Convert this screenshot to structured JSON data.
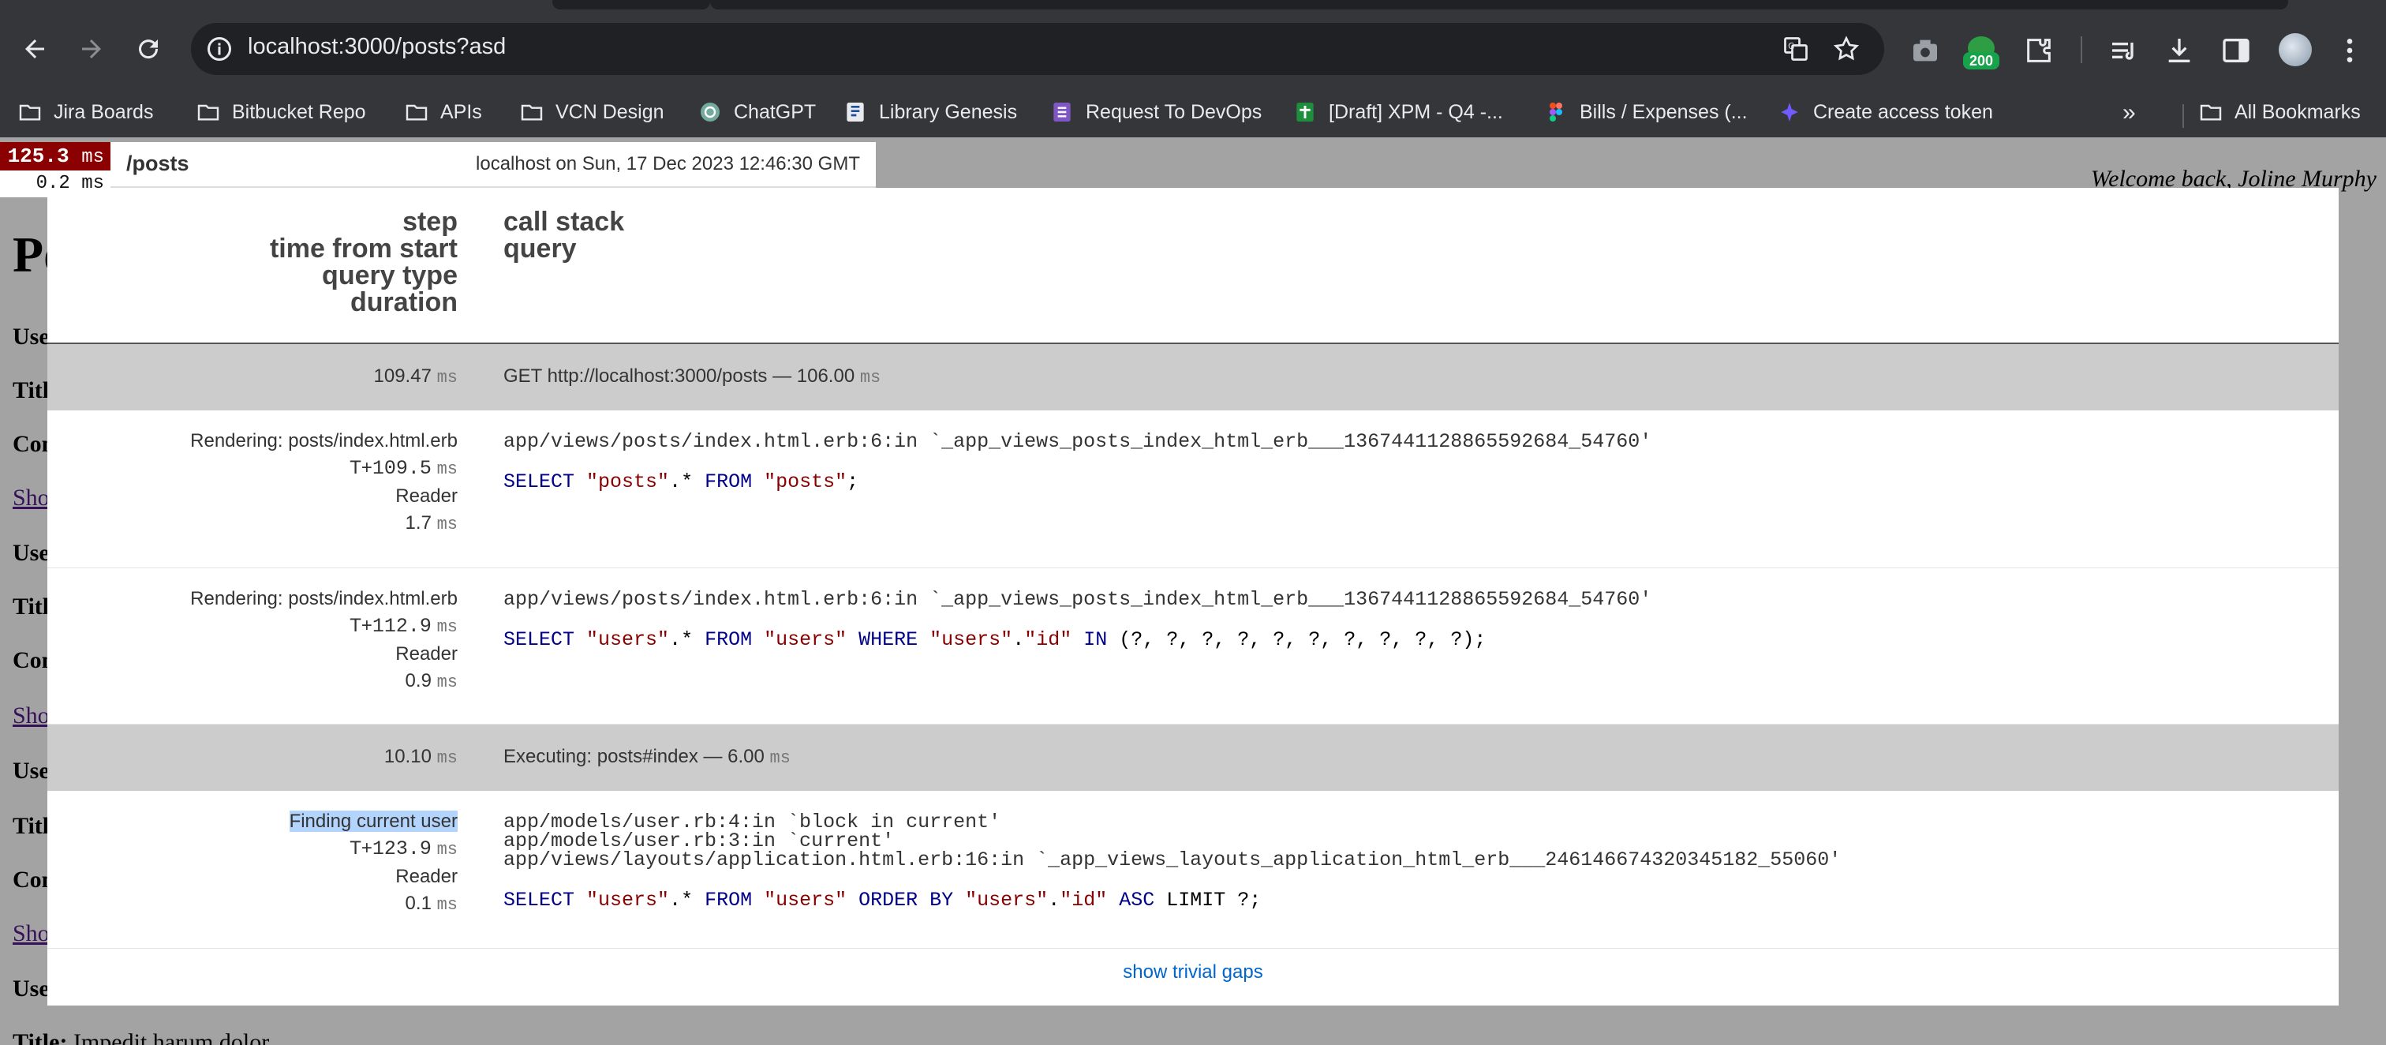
{
  "browser": {
    "url": "localhost:3000/posts?asd",
    "extension_badge": "200",
    "bookmarks": [
      {
        "label": "Jira Boards",
        "icon": "folder-icon"
      },
      {
        "label": "Bitbucket Repo",
        "icon": "folder-icon"
      },
      {
        "label": "APIs",
        "icon": "folder-icon"
      },
      {
        "label": "VCN Design",
        "icon": "folder-icon"
      },
      {
        "label": "ChatGPT",
        "icon": "chatgpt-icon"
      },
      {
        "label": "Library Genesis",
        "icon": "library-icon"
      },
      {
        "label": "Request To DevOps",
        "icon": "form-icon"
      },
      {
        "label": "[Draft] XPM - Q4 -...",
        "icon": "sheets-icon"
      },
      {
        "label": "Bills / Expenses (...",
        "icon": "figma-icon"
      },
      {
        "label": "Create access token",
        "icon": "sparkle-icon"
      }
    ],
    "more_bookmarks": "»",
    "all_bookmarks": "All Bookmarks"
  },
  "page": {
    "heading_fragment": "Po",
    "welcome": "Welcome back, Joline Murphy",
    "labels": [
      "Use",
      "Titl",
      "Con",
      "Use",
      "Titl",
      "Con",
      "Use",
      "Titl",
      "Con",
      "Use"
    ],
    "links": [
      "Sho",
      "Sho",
      "Sho"
    ],
    "last_title_label": "Title:",
    "last_title_value": "Impedit harum dolor"
  },
  "profiler": {
    "badge_total": "125.3",
    "badge_unit": "ms",
    "badge_sub": "0.2 ms",
    "path": "/posts",
    "server_info": "localhost on Sun, 17 Dec 2023 12:46:30 GMT",
    "headers_left": [
      "step",
      "time from start",
      "query type",
      "duration"
    ],
    "headers_right": [
      "call stack",
      "query"
    ],
    "unit": "ms",
    "rows": [
      {
        "kind": "timing",
        "time": "109.47",
        "label": "GET http://localhost:3000/posts — 106.00"
      },
      {
        "kind": "query",
        "step": "Rendering: posts/index.html.erb",
        "start_prefix": "T+",
        "start": "109.5",
        "type": "Reader",
        "duration": "1.7",
        "stack": "app/views/posts/index.html.erb:6:in `_app_views_posts_index_html_erb___1367441128865592684_54760'",
        "sql": [
          {
            "t": "SELECT ",
            "c": "kw"
          },
          {
            "t": "\"posts\"",
            "c": "str"
          },
          {
            "t": ".* ",
            "c": ""
          },
          {
            "t": "FROM ",
            "c": "kw"
          },
          {
            "t": "\"posts\"",
            "c": "str"
          },
          {
            "t": ";",
            "c": ""
          }
        ]
      },
      {
        "kind": "query",
        "step": "Rendering: posts/index.html.erb",
        "start_prefix": "T+",
        "start": "112.9",
        "type": "Reader",
        "duration": "0.9",
        "stack": "app/views/posts/index.html.erb:6:in `_app_views_posts_index_html_erb___1367441128865592684_54760'",
        "sql": [
          {
            "t": "SELECT ",
            "c": "kw"
          },
          {
            "t": "\"users\"",
            "c": "str"
          },
          {
            "t": ".* ",
            "c": ""
          },
          {
            "t": "FROM ",
            "c": "kw"
          },
          {
            "t": "\"users\"",
            "c": "str"
          },
          {
            "t": " ",
            "c": ""
          },
          {
            "t": "WHERE ",
            "c": "kw"
          },
          {
            "t": "\"users\"",
            "c": "str"
          },
          {
            "t": ".",
            "c": ""
          },
          {
            "t": "\"id\"",
            "c": "str"
          },
          {
            "t": " ",
            "c": ""
          },
          {
            "t": "IN ",
            "c": "kw"
          },
          {
            "t": "(?, ?, ?, ?, ?, ?, ?, ?, ?, ?);",
            "c": ""
          }
        ]
      },
      {
        "kind": "timing",
        "time": "10.10",
        "label": "Executing: posts#index — 6.00"
      },
      {
        "kind": "query",
        "step": "Finding current user",
        "highlight": true,
        "start_prefix": "T+",
        "start": "123.9",
        "type": "Reader",
        "duration": "0.1",
        "stack": "app/models/user.rb:4:in `block in current'\napp/models/user.rb:3:in `current'\napp/views/layouts/application.html.erb:16:in `_app_views_layouts_application_html_erb___2461466743203451​82_55060'",
        "sql": [
          {
            "t": "SELECT ",
            "c": "kw"
          },
          {
            "t": "\"users\"",
            "c": "str"
          },
          {
            "t": ".* ",
            "c": ""
          },
          {
            "t": "FROM ",
            "c": "kw"
          },
          {
            "t": "\"users\"",
            "c": "str"
          },
          {
            "t": " ",
            "c": ""
          },
          {
            "t": "ORDER BY ",
            "c": "kw"
          },
          {
            "t": "\"users\"",
            "c": "str"
          },
          {
            "t": ".",
            "c": ""
          },
          {
            "t": "\"id\"",
            "c": "str"
          },
          {
            "t": " ",
            "c": ""
          },
          {
            "t": "ASC ",
            "c": "kw"
          },
          {
            "t": "LIMIT ?;",
            "c": ""
          }
        ]
      }
    ],
    "show_trivial": "show trivial gaps"
  }
}
